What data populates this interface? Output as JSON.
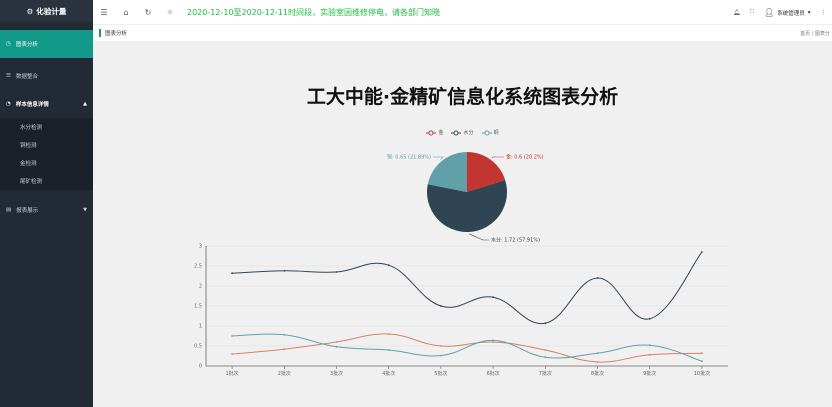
{
  "app": {
    "title": "化验计量"
  },
  "sidebar": {
    "items": [
      {
        "label": "图表分析",
        "icon": "chart-icon",
        "active": true
      },
      {
        "label": "数据整合",
        "icon": "list-icon"
      },
      {
        "label": "样本信息详情",
        "icon": "dashboard-icon",
        "expanded": true,
        "children": [
          "水分检测",
          "铜检测",
          "金检测",
          "尾矿检测"
        ]
      },
      {
        "label": "报表展示",
        "icon": "doc-icon",
        "expanded": false
      }
    ]
  },
  "topbar": {
    "notice": "2020-12-10至2020-12-11时间段，实验室因维修停电，请各部门知晓",
    "user": "系统管理员"
  },
  "breadcrumb": {
    "current": "图表分析",
    "home": "首页",
    "page": "图表分"
  },
  "main": {
    "title": "工大中能·金精矿信息化系统图表分析"
  },
  "chart_data": [
    {
      "type": "pie",
      "legend": [
        "金",
        "水分",
        "铜"
      ],
      "colors": [
        "#c23531",
        "#2f4554",
        "#61a0a8"
      ],
      "slices": [
        {
          "name": "金",
          "value": 0.6,
          "percent": "20.2%",
          "label": "金: 0.6 (20.2%)"
        },
        {
          "name": "水分",
          "value": 1.72,
          "percent": "57.91%",
          "label": "水分: 1.72 (57.91%)"
        },
        {
          "name": "铜",
          "value": 0.65,
          "percent": "21.89%",
          "label": "铜: 0.65 (21.89%)"
        }
      ]
    },
    {
      "type": "line",
      "categories": [
        "1批次",
        "2批次",
        "3批次",
        "4批次",
        "5批次",
        "6批次",
        "7批次",
        "8批次",
        "9批次",
        "10批次"
      ],
      "ylim": [
        0,
        3
      ],
      "yticks": [
        "0",
        "0.5",
        "1",
        "1.5",
        "2",
        "2.5",
        "3"
      ],
      "series": [
        {
          "name": "金",
          "color": "#d48265",
          "values": [
            0.3,
            0.42,
            0.6,
            0.8,
            0.5,
            0.6,
            0.4,
            0.1,
            0.28,
            0.32
          ]
        },
        {
          "name": "水分",
          "color": "#2f4554",
          "values": [
            2.32,
            2.38,
            2.35,
            2.52,
            1.5,
            1.72,
            1.07,
            2.2,
            1.18,
            2.85
          ]
        },
        {
          "name": "铜",
          "color": "#61a0a8",
          "values": [
            0.75,
            0.78,
            0.48,
            0.4,
            0.26,
            0.64,
            0.22,
            0.32,
            0.52,
            0.12
          ]
        }
      ]
    }
  ]
}
